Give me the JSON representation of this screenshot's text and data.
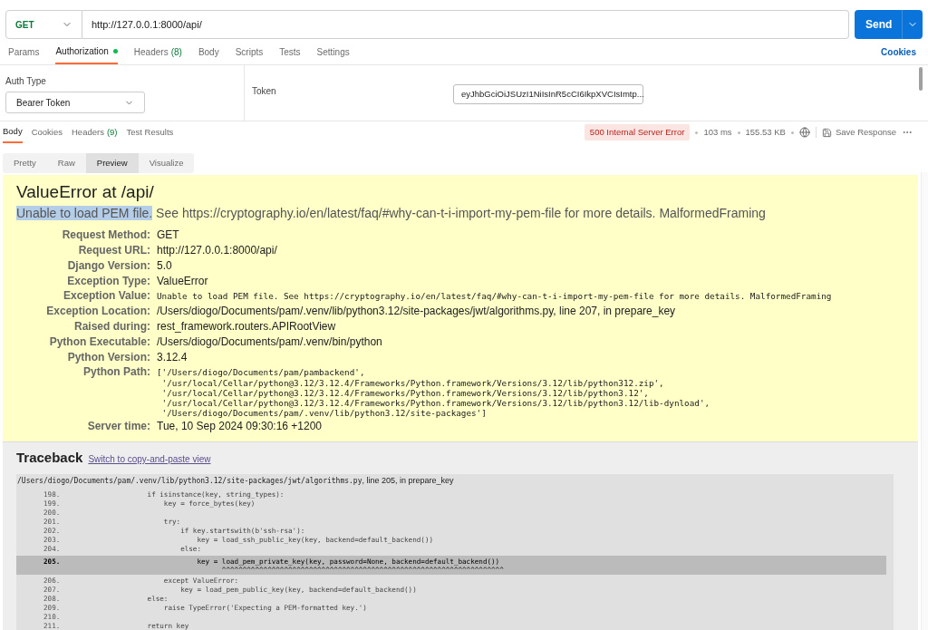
{
  "request": {
    "method": "GET",
    "url": "http://127.0.0.1:8000/api/",
    "send": "Send"
  },
  "request_tabs": [
    {
      "label": "Params",
      "selected": false
    },
    {
      "label": "Authorization",
      "selected": true,
      "dot": true
    },
    {
      "label": "Headers",
      "count": "(8)",
      "selected": false
    },
    {
      "label": "Body",
      "selected": false
    },
    {
      "label": "Scripts",
      "selected": false
    },
    {
      "label": "Tests",
      "selected": false
    },
    {
      "label": "Settings",
      "selected": false
    }
  ],
  "cookies_link": "Cookies",
  "auth": {
    "type_label": "Auth Type",
    "type_value": "Bearer Token",
    "token_label": "Token",
    "token_value": "eyJhbGciOiJSUzI1NiIsInR5cCI6IkpXVCIsImtp..."
  },
  "response_tabs": [
    {
      "label": "Body",
      "selected": true
    },
    {
      "label": "Cookies",
      "selected": false
    },
    {
      "label": "Headers",
      "count": "(9)",
      "selected": false
    },
    {
      "label": "Test Results",
      "selected": false
    }
  ],
  "status": {
    "code": "500 Internal Server Error",
    "time": "103 ms",
    "size": "155.53 KB",
    "save": "Save Response"
  },
  "view_tabs": [
    {
      "label": "Pretty",
      "selected": false
    },
    {
      "label": "Raw",
      "selected": false
    },
    {
      "label": "Preview",
      "selected": true
    },
    {
      "label": "Visualize",
      "selected": false
    }
  ],
  "error": {
    "title": "ValueError at /api/",
    "summary_selected": "Unable to load PEM file.",
    "summary_rest": "See https://cryptography.io/en/latest/faq/#why-can-t-i-import-my-pem-file for more details. MalformedFraming",
    "meta": [
      {
        "label": "Request Method:",
        "value": "GET",
        "kind": "text"
      },
      {
        "label": "Request URL:",
        "value": "http://127.0.0.1:8000/api/",
        "kind": "text"
      },
      {
        "label": "Django Version:",
        "value": "5.0",
        "kind": "text"
      },
      {
        "label": "Exception Type:",
        "value": "ValueError",
        "kind": "text"
      },
      {
        "label": "Exception Value:",
        "value": "Unable to load PEM file. See https://cryptography.io/en/latest/faq/#why-can-t-i-import-my-pem-file for more details. MalformedFraming",
        "kind": "code"
      },
      {
        "label": "Exception Location:",
        "value": "/Users/diogo/Documents/pam/.venv/lib/python3.12/site-packages/jwt/algorithms.py, line 207, in prepare_key",
        "kind": "text"
      },
      {
        "label": "Raised during:",
        "value": "rest_framework.routers.APIRootView",
        "kind": "text"
      },
      {
        "label": "Python Executable:",
        "value": "/Users/diogo/Documents/pam/.venv/bin/python",
        "kind": "text"
      },
      {
        "label": "Python Version:",
        "value": "3.12.4",
        "kind": "text"
      },
      {
        "label": "Python Path:",
        "value": "['/Users/diogo/Documents/pam/pambackend',\n '/usr/local/Cellar/python@3.12/3.12.4/Frameworks/Python.framework/Versions/3.12/lib/python312.zip',\n '/usr/local/Cellar/python@3.12/3.12.4/Frameworks/Python.framework/Versions/3.12/lib/python3.12',\n '/usr/local/Cellar/python@3.12/3.12.4/Frameworks/Python.framework/Versions/3.12/lib/python3.12/lib-dynload',\n '/Users/diogo/Documents/pam/.venv/lib/python3.12/site-packages']",
        "kind": "code"
      },
      {
        "label": "Server time:",
        "value": "Tue, 10 Sep 2024 09:30:16 +1200",
        "kind": "text"
      }
    ]
  },
  "traceback": {
    "title": "Traceback",
    "switch_link": "Switch to copy-and-paste view",
    "file_path": "/Users/diogo/Documents/pam/.venv/lib/python3.12/site-packages/jwt/algorithms.py",
    "file_location": ", line 205, in prepare_key",
    "lines": [
      {
        "number": "198.",
        "code": "        if isinstance(key, string_types):",
        "selected": false
      },
      {
        "number": "199.",
        "code": "            key = force_bytes(key)",
        "selected": false
      },
      {
        "number": "200.",
        "selected": false
      },
      {
        "number": "201.",
        "code": "            try:",
        "selected": false
      },
      {
        "number": "202.",
        "code": "                if key.startswith(b'ssh-rsa'):",
        "selected": false
      },
      {
        "number": "203.",
        "code": "                    key = load_ssh_public_key(key, backend=default_backend())",
        "selected": false
      },
      {
        "number": "204.",
        "code": "                else:",
        "selected": false
      },
      {
        "number": "205.",
        "code": "                    key = load_pem_private_key(key, password=None, backend=default_backend())",
        "carets": "                          ^^^^^^^^^^^^^^^^^^^^^^^^^^^^^^^^^^^^^^^^^^^^^^^^^^^^^^^^^^^^^^^^^^^^",
        "selected": true
      },
      {
        "number": "206.",
        "code": "            except ValueError:",
        "selected": false
      },
      {
        "number": "207.",
        "code": "                key = load_pem_public_key(key, backend=default_backend())",
        "selected": false
      },
      {
        "number": "208.",
        "code": "        else:",
        "selected": false
      },
      {
        "number": "209.",
        "code": "            raise TypeError('Expecting a PEM-formatted key.')",
        "selected": false
      },
      {
        "number": "210.",
        "selected": false
      },
      {
        "number": "211.",
        "code": "        return key",
        "selected": false
      }
    ]
  }
}
